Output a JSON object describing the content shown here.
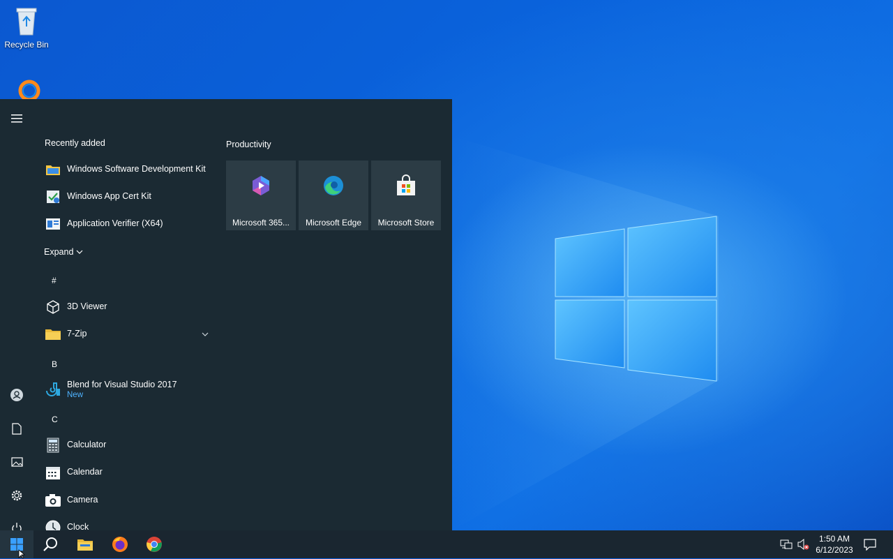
{
  "desktop": {
    "icons": [
      {
        "label": "Recycle Bin",
        "icon": "recycle-bin-icon"
      },
      {
        "label": "",
        "icon": "cortana-ring-icon"
      }
    ]
  },
  "start_menu": {
    "hamburger_icon": "menu-icon",
    "recently_added": {
      "heading": "Recently added",
      "items": [
        {
          "name": "Windows Software Development Kit",
          "icon": "folder-sdk-icon"
        },
        {
          "name": "Windows App Cert Kit",
          "icon": "cert-kit-icon"
        },
        {
          "name": "Application Verifier (X64)",
          "icon": "app-verifier-icon"
        }
      ]
    },
    "expand_label": "Expand",
    "groups": [
      {
        "letter": "#",
        "items": [
          {
            "name": "3D Viewer",
            "icon": "cube-icon",
            "sub": ""
          },
          {
            "name": "7-Zip",
            "icon": "folder-icon",
            "sub": "",
            "has_chevron": true
          }
        ]
      },
      {
        "letter": "B",
        "items": [
          {
            "name": "Blend for Visual Studio 2017",
            "icon": "blend-icon",
            "sub": "New"
          }
        ]
      },
      {
        "letter": "C",
        "items": [
          {
            "name": "Calculator",
            "icon": "calculator-icon",
            "sub": ""
          },
          {
            "name": "Calendar",
            "icon": "calendar-icon",
            "sub": ""
          },
          {
            "name": "Camera",
            "icon": "camera-icon",
            "sub": ""
          },
          {
            "name": "Clock",
            "icon": "clock-icon",
            "sub": ""
          }
        ]
      }
    ],
    "rail": [
      "account-icon",
      "documents-icon",
      "pictures-icon",
      "settings-icon",
      "power-icon"
    ],
    "tiles_group": {
      "heading": "Productivity",
      "tiles": [
        {
          "label": "Microsoft 365...",
          "icon": "microsoft-365-icon"
        },
        {
          "label": "Microsoft Edge",
          "icon": "edge-icon"
        },
        {
          "label": "Microsoft Store",
          "icon": "store-icon"
        }
      ]
    }
  },
  "taskbar": {
    "buttons": [
      "windows-start-icon",
      "search-icon",
      "file-explorer-icon",
      "firefox-icon",
      "chrome-icon"
    ],
    "tray": [
      "network-icon",
      "volume-muted-icon"
    ],
    "time": "1:50 AM",
    "date": "6/12/2023",
    "notifications_icon": "notifications-icon"
  },
  "colors": {
    "start_bg": "#1b2a33",
    "tile_bg": "#2c3c45",
    "taskbar_bg": "#1a2630",
    "accent_new": "#4fb3ff",
    "wallpaper": "#0a5bd6"
  }
}
